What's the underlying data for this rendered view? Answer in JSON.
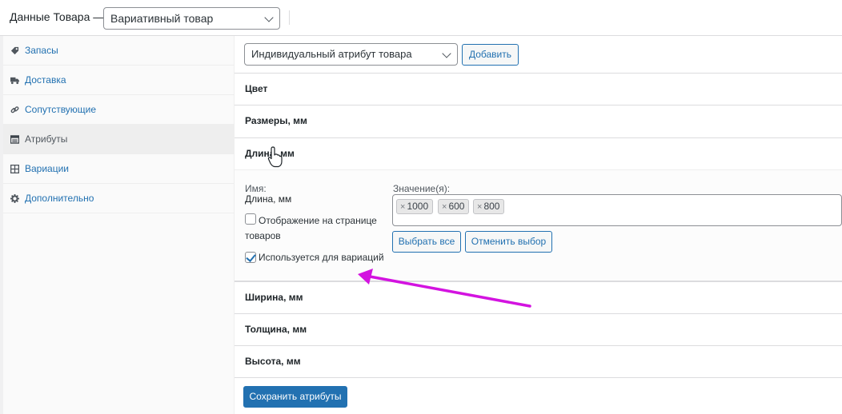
{
  "header": {
    "title": "Данные Товара —",
    "product_type": "Вариативный товар"
  },
  "sidebar": {
    "items": [
      {
        "label": "Запасы",
        "icon": "tag-icon"
      },
      {
        "label": "Доставка",
        "icon": "truck-icon"
      },
      {
        "label": "Сопутствующие",
        "icon": "link-icon"
      },
      {
        "label": "Атрибуты",
        "icon": "table-icon",
        "active": true
      },
      {
        "label": "Вариации",
        "icon": "grid-icon"
      },
      {
        "label": "Дополнительно",
        "icon": "gear-icon"
      }
    ]
  },
  "toolbar": {
    "attribute_select": "Индивидуальный атрибут товара",
    "add_button": "Добавить"
  },
  "attributes": [
    {
      "title": "Цвет"
    },
    {
      "title": "Размеры, мм"
    },
    {
      "title": "Длина, мм",
      "expanded": true
    },
    {
      "title": "Ширина, мм"
    },
    {
      "title": "Толщина, мм"
    },
    {
      "title": "Высота, мм"
    }
  ],
  "expanded_attribute": {
    "name_label": "Имя:",
    "name_value": "Длина, мм",
    "visible_checkbox_label": "Отображение на странице товаров",
    "visible_checked": false,
    "variation_checkbox_label": "Используется для вариаций",
    "variation_checked": true,
    "values_label": "Значение(я):",
    "values": [
      "1000",
      "600",
      "800"
    ],
    "remove_glyph": "×",
    "select_all_button": "Выбрать все",
    "deselect_button": "Отменить выбор"
  },
  "save_button": "Сохранить атрибуты",
  "colors": {
    "accent": "#2271b1",
    "annotation_arrow": "#d313e0"
  }
}
